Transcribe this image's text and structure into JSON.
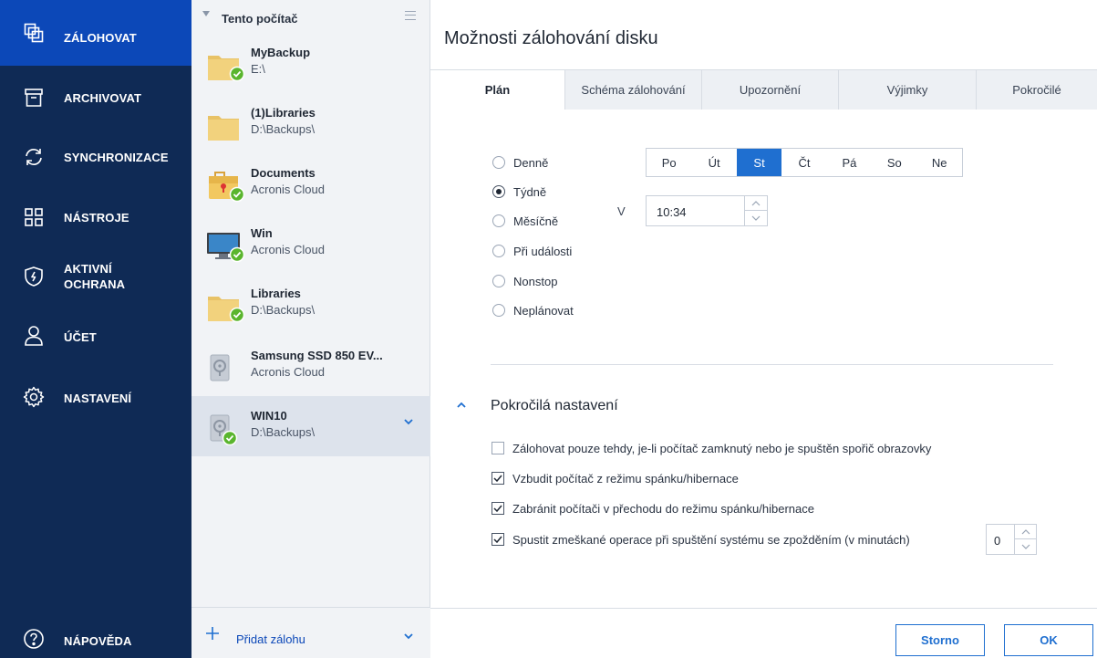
{
  "nav": {
    "items": [
      {
        "label": "ZÁLOHOVAT",
        "icon": "backup-icon",
        "active": true
      },
      {
        "label": "ARCHIVOVAT",
        "icon": "archive-icon"
      },
      {
        "label": "SYNCHRONIZACE",
        "icon": "sync-icon"
      },
      {
        "label": "NÁSTROJE",
        "icon": "tools-grid-icon"
      },
      {
        "label_line1": "AKTIVNÍ",
        "label_line2": "OCHRANA",
        "icon": "shield-icon"
      },
      {
        "label": "ÚČET",
        "icon": "account-icon"
      },
      {
        "label": "NASTAVENÍ",
        "icon": "gear-icon"
      }
    ],
    "help": {
      "label": "NÁPOVĚDA",
      "icon": "help-icon"
    }
  },
  "list": {
    "header": "Tento počítač",
    "items": [
      {
        "name": "MyBackup",
        "path": "E:\\",
        "icon": "folder-icon",
        "status": "ok"
      },
      {
        "name": "(1)Libraries",
        "path": "D:\\Backups\\",
        "icon": "folder-icon"
      },
      {
        "name": "Documents",
        "path": "Acronis Cloud",
        "icon": "briefcase-icon",
        "status": "ok"
      },
      {
        "name": "Win",
        "path": "Acronis Cloud",
        "icon": "monitor-icon",
        "status": "ok"
      },
      {
        "name": "Libraries",
        "path": "D:\\Backups\\",
        "icon": "folder-icon",
        "status": "ok"
      },
      {
        "name": "Samsung SSD 850 EV...",
        "path": "Acronis Cloud",
        "icon": "disk-icon"
      },
      {
        "name": "WIN10",
        "path": "D:\\Backups\\",
        "icon": "disk-icon",
        "status": "ok",
        "selected": true
      }
    ],
    "footer": "Přidat zálohu"
  },
  "main": {
    "title": "Možnosti zálohování disku",
    "tabs": [
      "Plán",
      "Schéma zálohování",
      "Upozornění",
      "Výjimky",
      "Pokročilé"
    ],
    "active_tab": "Plán",
    "schedule_options": [
      "Denně",
      "Týdně",
      "Měsíčně",
      "Při události",
      "Nonstop",
      "Neplánovat"
    ],
    "selected_option": "Týdně",
    "days": [
      "Po",
      "Út",
      "St",
      "Čt",
      "Pá",
      "So",
      "Ne"
    ],
    "selected_day": "St",
    "time_label": "V",
    "time_value": "10:34",
    "advanced": {
      "title": "Pokročilá nastavení",
      "options": [
        {
          "label": "Zálohovat pouze tehdy, je-li počítač zamknutý nebo je spuštěn spořič obrazovky",
          "checked": false
        },
        {
          "label": "Vzbudit počítač z režimu spánku/hibernace",
          "checked": true
        },
        {
          "label": "Zabránit počítači v přechodu do režimu spánku/hibernace",
          "checked": true
        },
        {
          "label": "Spustit zmeškané operace při spuštění systému se zpožděním (v minutách)",
          "checked": true
        }
      ],
      "delay_value": "0"
    },
    "buttons": {
      "cancel": "Storno",
      "ok": "OK"
    }
  },
  "colors": {
    "nav_bg": "#0f2a55",
    "nav_active": "#0c48b8",
    "accent": "#1f6fd0",
    "status_ok": "#5ab52e"
  }
}
